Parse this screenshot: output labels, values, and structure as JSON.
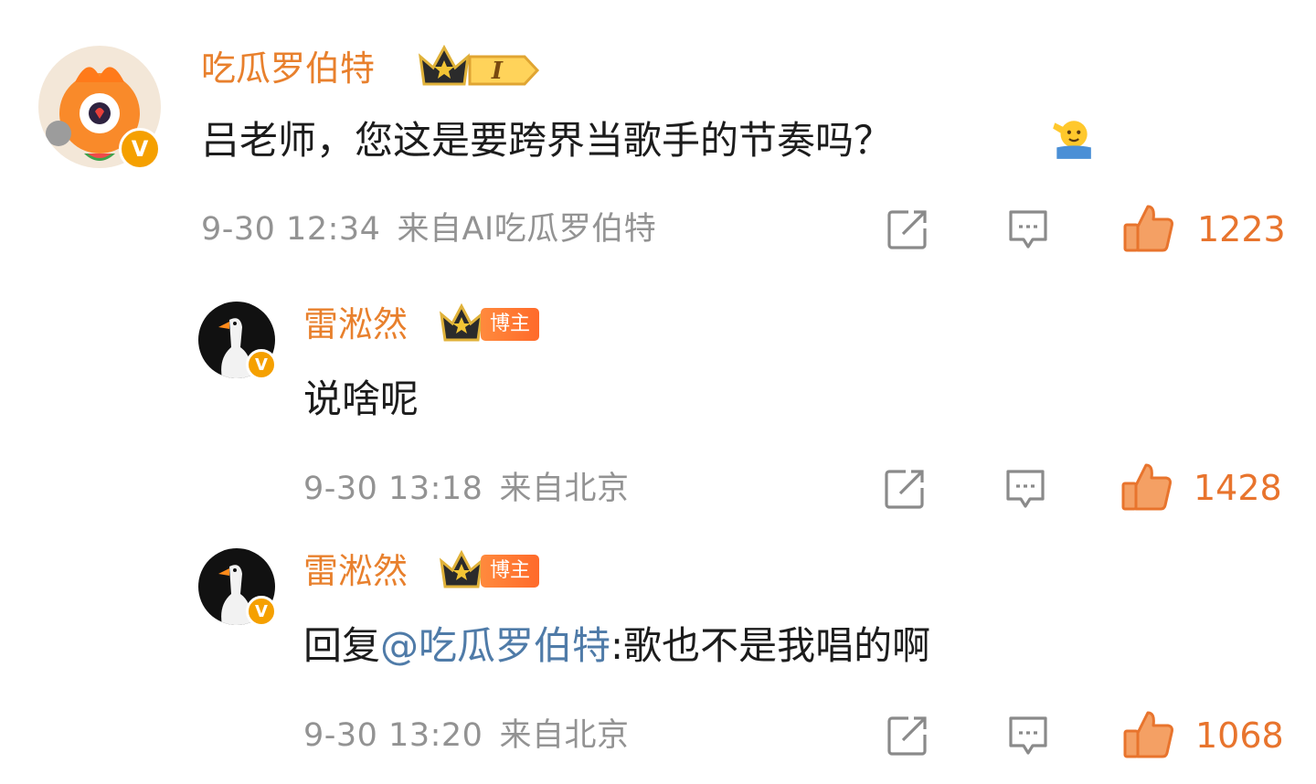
{
  "comments": [
    {
      "username": "吃瓜罗伯特",
      "level_badge": "I",
      "text": "吕老师，您这是要跨界当歌手的节奏吗？",
      "emoji": "salute-emoji",
      "time": "9-30 12:34",
      "source": "来自AI吃瓜罗伯特",
      "likes": "1223"
    },
    {
      "username": "雷淞然",
      "role_badge": "博主",
      "text": "说啥呢",
      "time": "9-30 13:18",
      "source": "来自北京",
      "likes": "1428"
    },
    {
      "username": "雷淞然",
      "role_badge": "博主",
      "reply_prefix": "回复",
      "mention": "@吃瓜罗伯特",
      "reply_text": ":歌也不是我唱的啊",
      "time": "9-30 13:20",
      "source": "来自北京",
      "likes": "1068"
    }
  ],
  "colors": {
    "username": "#e8802d",
    "mention": "#4f7ba8",
    "meta": "#939393",
    "like": "#e8742d"
  }
}
